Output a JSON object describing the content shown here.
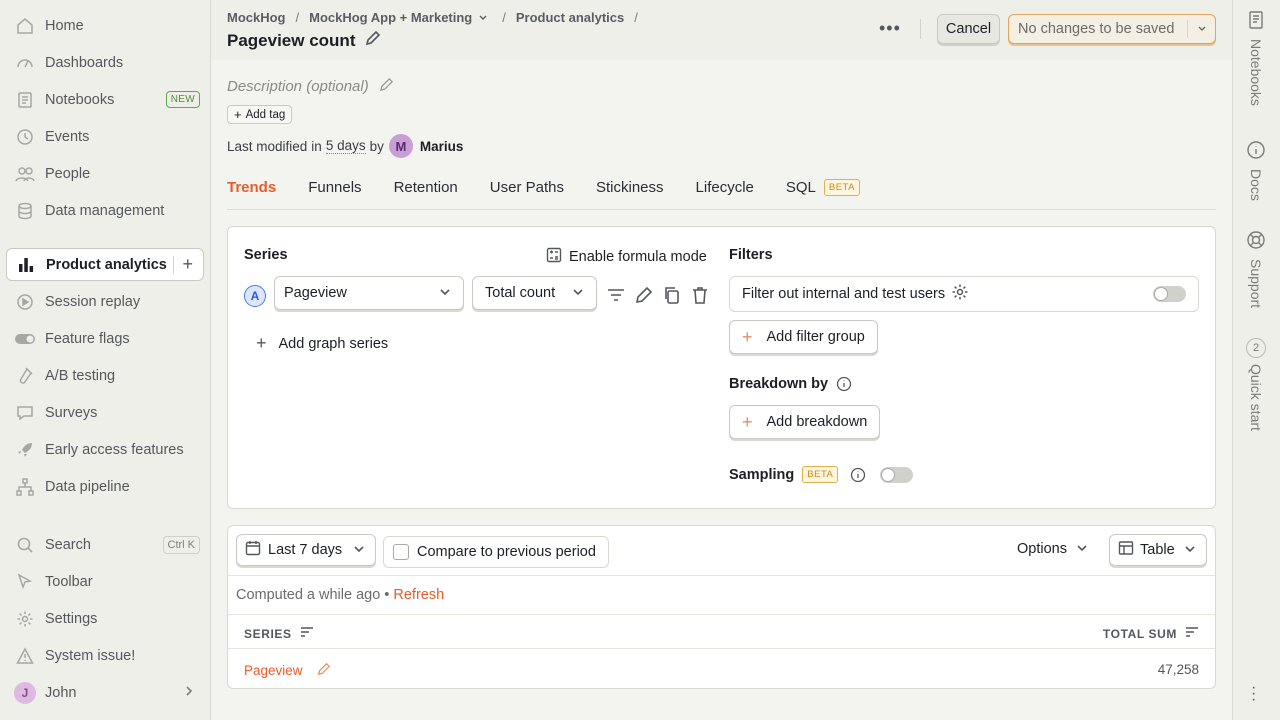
{
  "sidebar": {
    "items": [
      {
        "label": "Home",
        "icon": "home-icon"
      },
      {
        "label": "Dashboards",
        "icon": "dashboard-icon"
      },
      {
        "label": "Notebooks",
        "icon": "notebook-icon",
        "badge": "NEW"
      },
      {
        "label": "Events",
        "icon": "events-icon"
      },
      {
        "label": "People",
        "icon": "people-icon"
      },
      {
        "label": "Data management",
        "icon": "database-icon"
      },
      {
        "label": "Product analytics",
        "icon": "bar-chart-icon",
        "active": true
      },
      {
        "label": "Session replay",
        "icon": "replay-icon"
      },
      {
        "label": "Feature flags",
        "icon": "toggle-icon"
      },
      {
        "label": "A/B testing",
        "icon": "flask-icon"
      },
      {
        "label": "Surveys",
        "icon": "survey-icon"
      },
      {
        "label": "Early access features",
        "icon": "rocket-icon"
      },
      {
        "label": "Data pipeline",
        "icon": "pipeline-icon"
      }
    ],
    "bottom": [
      {
        "label": "Search",
        "icon": "search-icon",
        "shortcut": "Ctrl K"
      },
      {
        "label": "Toolbar",
        "icon": "toolbar-icon"
      },
      {
        "label": "Settings",
        "icon": "gear-icon"
      },
      {
        "label": "System issue!",
        "icon": "warning-icon"
      },
      {
        "label": "John",
        "avatar": "J"
      }
    ]
  },
  "header": {
    "breadcrumbs": [
      "MockHog",
      "MockHog App + Marketing",
      "Product analytics"
    ],
    "title": "Pageview count",
    "cancel_label": "Cancel",
    "save_label": "No changes to be saved"
  },
  "meta": {
    "description_placeholder": "Description (optional)",
    "add_tag_label": "Add tag",
    "modified_prefix": "Last modified",
    "modified_in": "in",
    "modified_when": "5 days",
    "modified_by": "by",
    "author_initial": "M",
    "author": "Marius"
  },
  "tabs": [
    {
      "label": "Trends",
      "active": true
    },
    {
      "label": "Funnels"
    },
    {
      "label": "Retention"
    },
    {
      "label": "User Paths"
    },
    {
      "label": "Stickiness"
    },
    {
      "label": "Lifecycle"
    },
    {
      "label": "SQL",
      "badge": "BETA"
    }
  ],
  "series_panel": {
    "title": "Series",
    "formula_label": "Enable formula mode",
    "series_letter": "A",
    "event": "Pageview",
    "aggregation": "Total count",
    "add_series_label": "Add graph series"
  },
  "filters_panel": {
    "title": "Filters",
    "internal_filter_label": "Filter out internal and test users",
    "internal_filter_enabled": false,
    "add_filter_group_label": "Add filter group",
    "breakdown_title": "Breakdown by",
    "add_breakdown_label": "Add breakdown",
    "sampling_title": "Sampling",
    "sampling_badge": "BETA",
    "sampling_enabled": false
  },
  "results": {
    "date_range": "Last 7 days",
    "compare_label": "Compare to previous period",
    "options_label": "Options",
    "view_label": "Table",
    "computed_text": "Computed a while ago",
    "refresh_label": "Refresh",
    "columns": [
      "SERIES",
      "TOTAL SUM"
    ],
    "rows": [
      {
        "series": "Pageview",
        "total": "47,258"
      }
    ]
  },
  "right_rail": {
    "items": [
      {
        "label": "Notebooks",
        "icon": "notebook-icon"
      },
      {
        "label": "Docs",
        "icon": "info-icon"
      },
      {
        "label": "Support",
        "icon": "lifebuoy-icon"
      },
      {
        "label": "Quick start",
        "icon": "progress-icon",
        "count": "2"
      }
    ]
  },
  "colors": {
    "accent": "#eb5a2a",
    "series_blue": "#4a7ae8",
    "beta": "#c98a1a",
    "new_badge": "#4e9a2a"
  }
}
